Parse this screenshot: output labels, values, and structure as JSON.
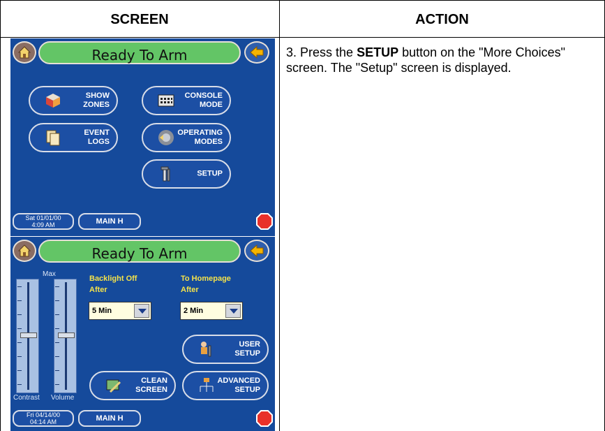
{
  "table": {
    "header_screen": "SCREEN",
    "header_action": "ACTION"
  },
  "action": {
    "prefix": "3.  Press the ",
    "button": "SETUP",
    "suffix": " button on the \"More Choices\" screen.  The \"Setup\" screen is displayed."
  },
  "screen1": {
    "status": "Ready To Arm",
    "buttons": {
      "show_zones": [
        "SHOW",
        "ZONES"
      ],
      "console_mode": [
        "CONSOLE",
        "MODE"
      ],
      "event_logs": [
        "EVENT",
        "LOGS"
      ],
      "operating_modes": [
        "OPERATING",
        "MODES"
      ],
      "setup": [
        "SETUP"
      ]
    },
    "date": [
      "Sat 01/01/00",
      "4:09 AM"
    ],
    "partition": "MAIN H"
  },
  "screen2": {
    "status": "Ready To Arm",
    "max_label": "Max",
    "contrast_label": "Contrast",
    "volume_label": "Volume",
    "backlight": {
      "line1": "Backlight Off",
      "line2": "After",
      "value": "5 Min"
    },
    "homepage": {
      "line1": "To Homepage",
      "line2": "After",
      "value": "2 Min"
    },
    "buttons": {
      "user_setup": [
        "USER",
        "SETUP"
      ],
      "clean_screen": [
        "CLEAN",
        "SCREEN"
      ],
      "advanced_setup": [
        "ADVANCED",
        "SETUP"
      ]
    },
    "date": [
      "Fri 04/14/00",
      "04:14 AM"
    ],
    "partition": "MAIN H"
  },
  "colors": {
    "screen_bg": "#154a9b",
    "status_green": "#63c566",
    "label_yellow": "#f4e24a",
    "stop_red": "#e8312a"
  }
}
